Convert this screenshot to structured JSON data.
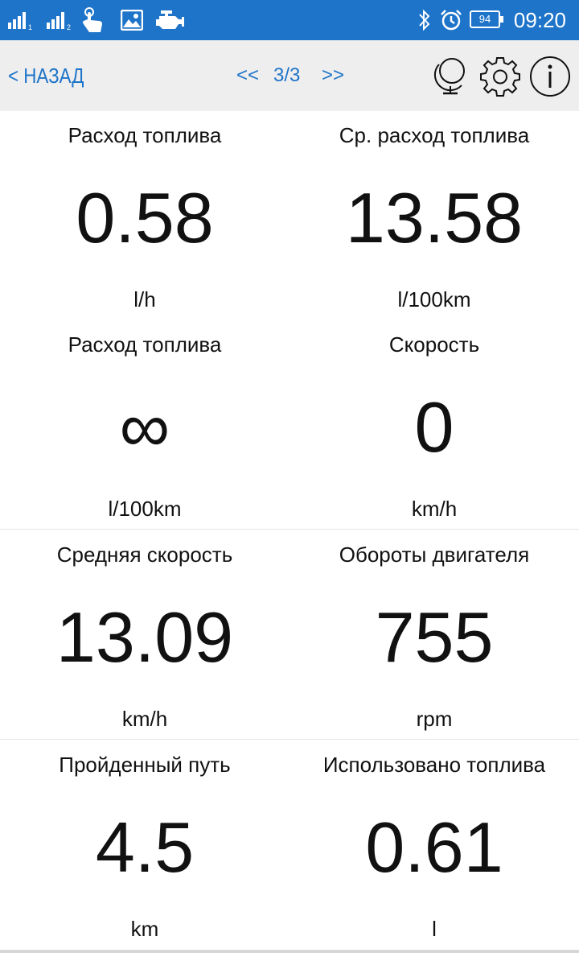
{
  "status_bar": {
    "time": "09:20",
    "battery_level": "94",
    "sim1_label": "1",
    "sim2_label": "2",
    "icons": [
      "signal-sim1-icon",
      "signal-sim2-icon",
      "touch-hand-icon",
      "image-notification-icon",
      "car-engine-icon",
      "bluetooth-icon",
      "alarm-clock-icon",
      "battery-icon"
    ],
    "background_color": "#1e74c9"
  },
  "toolbar": {
    "back_label": "< НАЗАД",
    "prev_label": "<<",
    "page_indicator": "3/3",
    "next_label": ">>",
    "accent_color": "#1e74c9",
    "icons": [
      "globe-icon",
      "gear-icon",
      "info-icon"
    ]
  },
  "gauges": [
    {
      "title": "Расход топлива",
      "value": "0.58",
      "unit": "l/h"
    },
    {
      "title": "Ср. расход топлива",
      "value": "13.58",
      "unit": "l/100km"
    },
    {
      "title": "Расход топлива",
      "value": "∞",
      "unit": "l/100km"
    },
    {
      "title": "Скорость",
      "value": "0",
      "unit": "km/h"
    },
    {
      "title": "Средняя скорость",
      "value": "13.09",
      "unit": "km/h"
    },
    {
      "title": "Обороты двигателя",
      "value": "755",
      "unit": "rpm"
    },
    {
      "title": "Пройденный путь",
      "value": "4.5",
      "unit": "km"
    },
    {
      "title": "Использовано топлива",
      "value": "0.61",
      "unit": "l"
    }
  ]
}
